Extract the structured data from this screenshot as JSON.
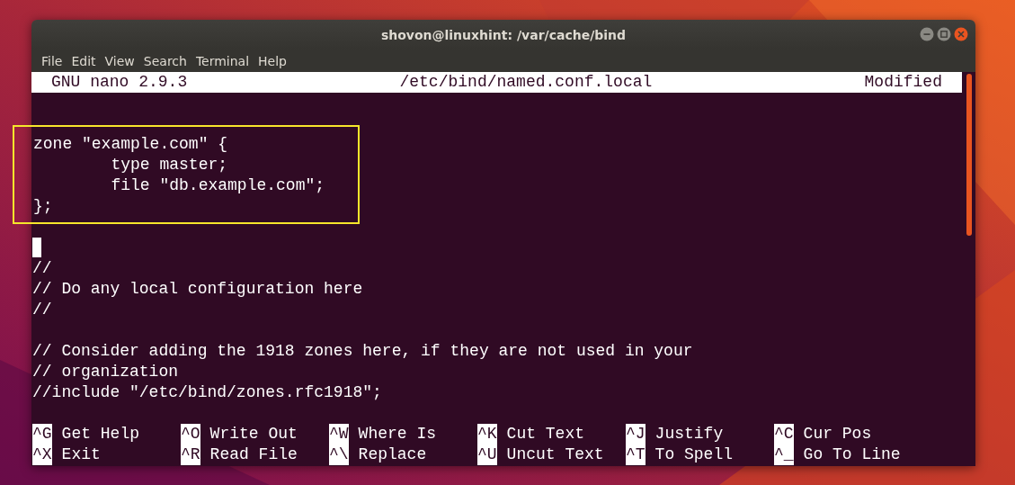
{
  "window": {
    "title": "shovon@linuxhint: /var/cache/bind"
  },
  "menu": [
    "File",
    "Edit",
    "View",
    "Search",
    "Terminal",
    "Help"
  ],
  "nano_header": {
    "version": "GNU nano 2.9.3",
    "file": "/etc/bind/named.conf.local",
    "status": "Modified"
  },
  "editor": {
    "lines": [
      {
        "kind": "blank"
      },
      {
        "kind": "blank"
      },
      {
        "kind": "highlight",
        "lines": [
          "zone \"example.com\" {",
          "        type master;",
          "        file \"db.example.com\";",
          "};"
        ]
      },
      {
        "kind": "blank"
      },
      {
        "kind": "cursor"
      },
      {
        "kind": "text",
        "text": "//"
      },
      {
        "kind": "text",
        "text": "// Do any local configuration here"
      },
      {
        "kind": "text",
        "text": "//"
      },
      {
        "kind": "blank"
      },
      {
        "kind": "text",
        "text": "// Consider adding the 1918 zones here, if they are not used in your"
      },
      {
        "kind": "text",
        "text": "// organization"
      },
      {
        "kind": "text",
        "text": "//include \"/etc/bind/zones.rfc1918\";"
      },
      {
        "kind": "blank"
      }
    ]
  },
  "shortcuts": [
    {
      "key": "^G",
      "label": "Get Help"
    },
    {
      "key": "^O",
      "label": "Write Out"
    },
    {
      "key": "^W",
      "label": "Where Is"
    },
    {
      "key": "^K",
      "label": "Cut Text"
    },
    {
      "key": "^J",
      "label": "Justify"
    },
    {
      "key": "^C",
      "label": "Cur Pos"
    },
    {
      "key": "^X",
      "label": "Exit"
    },
    {
      "key": "^R",
      "label": "Read File"
    },
    {
      "key": "^\\",
      "label": "Replace"
    },
    {
      "key": "^U",
      "label": "Uncut Text"
    },
    {
      "key": "^T",
      "label": "To Spell"
    },
    {
      "key": "^_",
      "label": "Go To Line"
    }
  ]
}
